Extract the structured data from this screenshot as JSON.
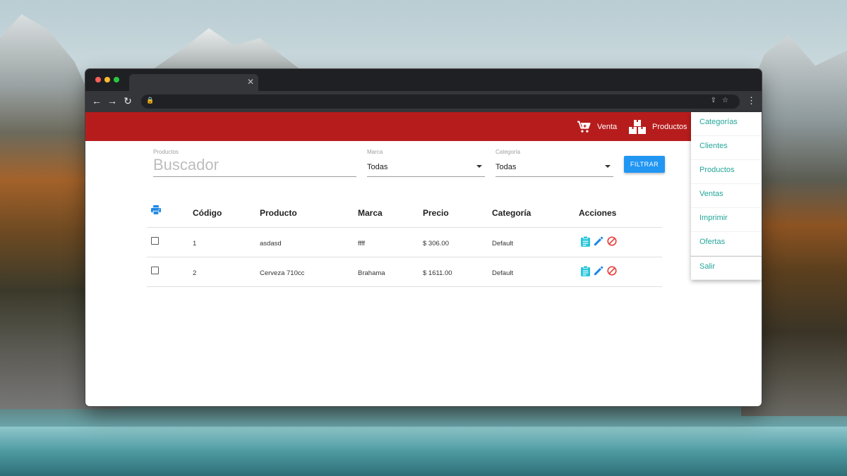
{
  "appbar": {
    "venta_label": "Venta",
    "productos_label": "Productos",
    "color": "#b71c1c"
  },
  "menu": {
    "items": [
      {
        "label": "Categorías"
      },
      {
        "label": "Clientes"
      },
      {
        "label": "Productos"
      },
      {
        "label": "Ventas"
      },
      {
        "label": "Imprimir"
      },
      {
        "label": "Ofertas"
      },
      {
        "label": "Salir"
      }
    ],
    "color": "#26a69a"
  },
  "filters": {
    "search": {
      "label": "Productos",
      "placeholder": "Buscador",
      "value": ""
    },
    "marca": {
      "label": "Marca",
      "value": "Todas"
    },
    "categoria": {
      "label": "Categoría",
      "value": "Todas"
    },
    "filter_button": "FILTRAR"
  },
  "table": {
    "headers": [
      "Código",
      "Producto",
      "Marca",
      "Precio",
      "Categoría",
      "Acciones"
    ],
    "rows": [
      {
        "codigo": "1",
        "producto": "asdasd",
        "marca": "ffff",
        "precio": "$ 306.00",
        "categoria": "Default"
      },
      {
        "codigo": "2",
        "producto": "Cerveza 710cc",
        "marca": "Brahama",
        "precio": "$ 1611.00",
        "categoria": "Default"
      }
    ]
  },
  "icons": {
    "print": "print-icon",
    "clipboard": "clipboard-icon",
    "edit": "pencil-icon",
    "disable": "block-icon"
  }
}
